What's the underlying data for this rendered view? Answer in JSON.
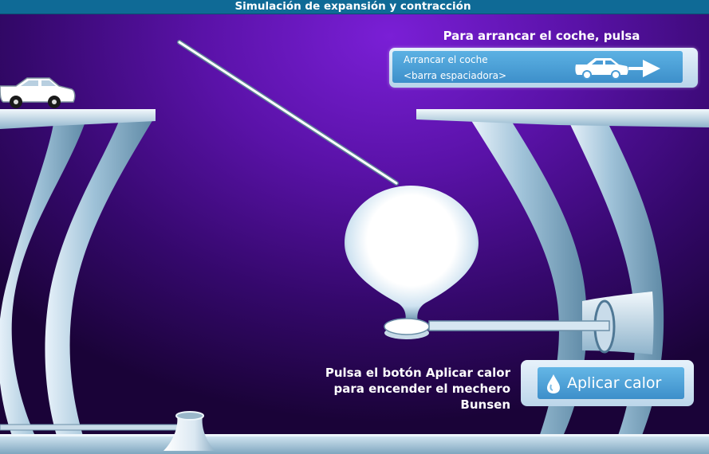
{
  "app": {
    "title": "Simulación de expansión y contracción"
  },
  "instructions": {
    "start_car": "Para arrancar el coche, pulsa",
    "apply_heat_lines": [
      "Pulsa el botón Aplicar calor",
      "para encender el mechero",
      "Bunsen"
    ]
  },
  "controls": {
    "start_car": {
      "line1": "Arrancar el coche",
      "line2": "<barra espaciadora>"
    },
    "apply_heat": {
      "label": "Aplicar calor"
    }
  },
  "icons": [
    "car-icon",
    "right-arrow-icon",
    "flame-drop-icon"
  ],
  "colors": {
    "title_bar": "#0f6a96",
    "background": "#5a12a8",
    "button": "#3d8fca",
    "panel": "#d9eaf7"
  }
}
